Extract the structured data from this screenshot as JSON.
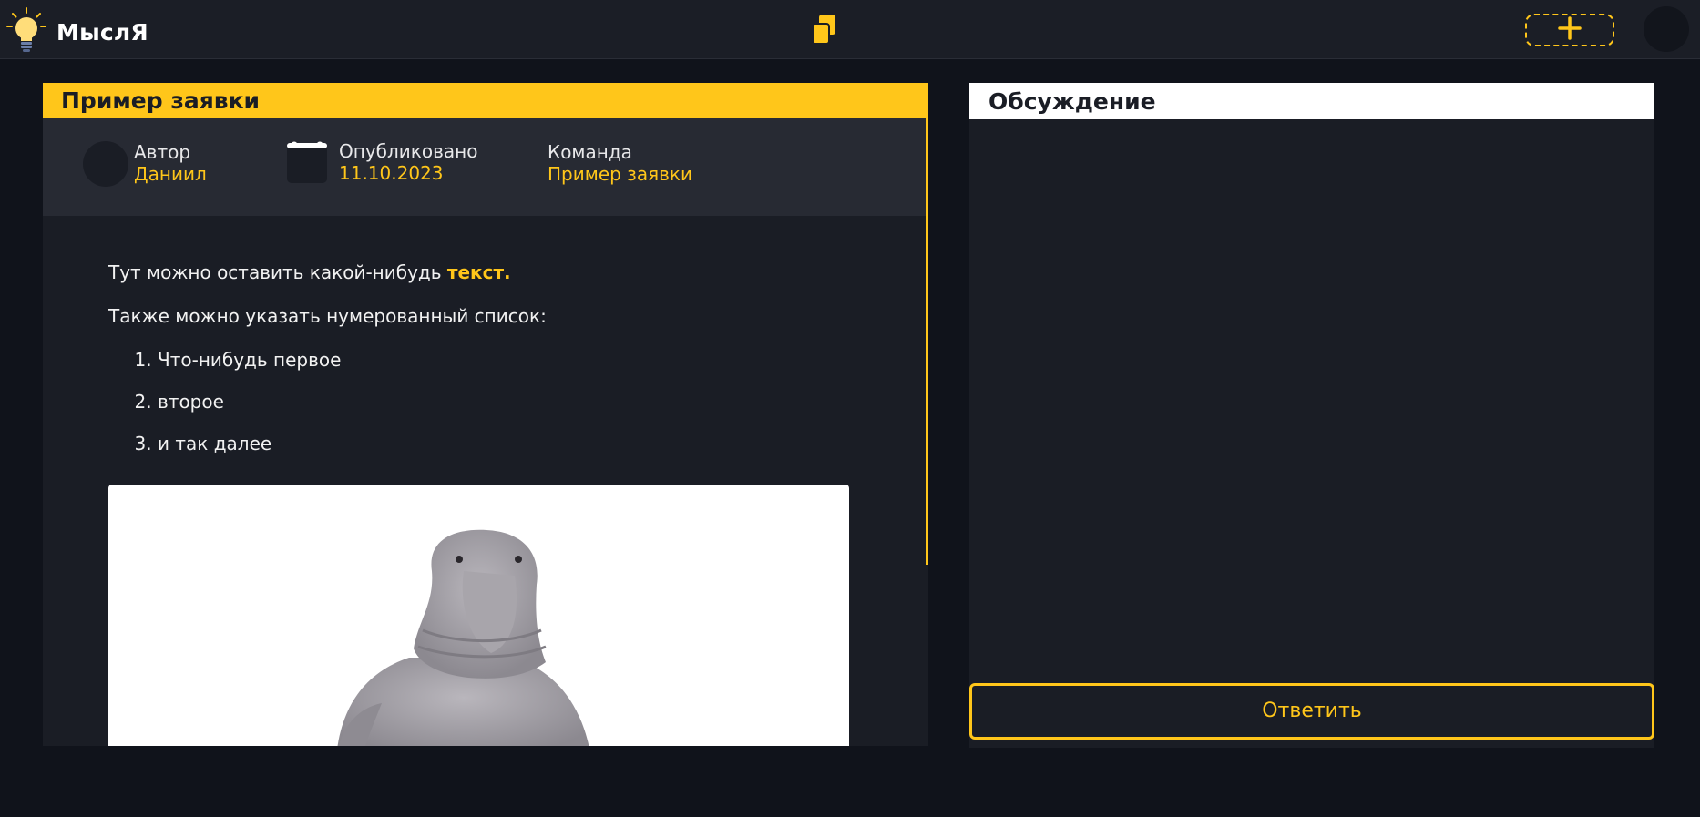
{
  "header": {
    "logo_text": "МыслЯ",
    "logo_icon": "lightbulb-icon",
    "center_icon": "stacked-pages-icon",
    "add_icon": "plus-icon"
  },
  "post": {
    "title": "Пример заявки",
    "author_label": "Автор",
    "author_value": "Даниил",
    "published_label": "Опубликовано",
    "published_value": "11.10.2023",
    "team_label": "Команда",
    "team_value": "Пример заявки",
    "paragraph1_text": "Тут можно оставить какой-нибудь ",
    "paragraph1_highlight": "текст.",
    "paragraph2": "Также можно указать нумерованный список:",
    "list_items": [
      "Что-нибудь первое",
      "второе",
      "и так далее"
    ],
    "image_icon": "walrus-image"
  },
  "discussion": {
    "title": "Обсуждение",
    "reply_label": "Ответить"
  },
  "colors": {
    "accent": "#ffc61a",
    "background": "#10131b",
    "panel": "#1a1d25",
    "meta_bar": "#272a33"
  }
}
